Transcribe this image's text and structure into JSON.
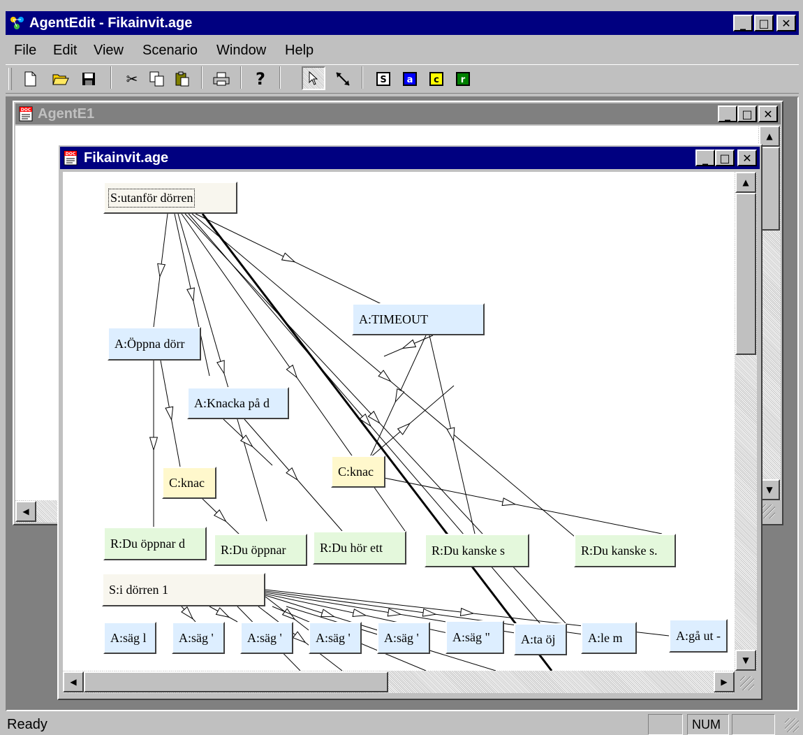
{
  "app": {
    "title": "AgentEdit - Fikainvit.age",
    "caption_buttons": {
      "minimize": "_",
      "maximize": "□",
      "close": "✕"
    }
  },
  "menu": [
    "File",
    "Edit",
    "View",
    "Scenario",
    "Window",
    "Help"
  ],
  "toolbar": {
    "icons": [
      "new-document-icon",
      "open-folder-icon",
      "save-icon",
      "cut-icon",
      "copy-icon",
      "paste-icon",
      "print-icon",
      "help-icon",
      "pointer-select-icon",
      "connect-arrow-icon",
      "state-node-icon",
      "action-node-icon",
      "condition-node-icon",
      "response-node-icon"
    ],
    "node_letters": {
      "s": "S",
      "a": "a",
      "c": "c",
      "r": "r"
    },
    "node_colors": {
      "s": "#ffffff",
      "a": "#0000ff",
      "c": "#ffff00",
      "r": "#008000"
    }
  },
  "outer_window": {
    "title": "AgentE1"
  },
  "inner_window": {
    "title": "Fikainvit.age"
  },
  "nodes": [
    {
      "key": "n0",
      "kind": "state",
      "label": "S:utanför dörren",
      "selected": true
    },
    {
      "key": "n1",
      "kind": "action",
      "label": "A:TIMEOUT"
    },
    {
      "key": "n2",
      "kind": "action",
      "label": "A:Öppna dörr"
    },
    {
      "key": "n3",
      "kind": "action",
      "label": "A:Knacka på d"
    },
    {
      "key": "n4",
      "kind": "condition",
      "label": "C:knac"
    },
    {
      "key": "n5",
      "kind": "condition",
      "label": "C:knac"
    },
    {
      "key": "n6",
      "kind": "response",
      "label": "R:Du öppnar d"
    },
    {
      "key": "n7",
      "kind": "response",
      "label": "R:Du öppnar"
    },
    {
      "key": "n8",
      "kind": "response",
      "label": "R:Du hör ett"
    },
    {
      "key": "n9",
      "kind": "response",
      "label": "R:Du kanske s"
    },
    {
      "key": "n10",
      "kind": "response",
      "label": "R:Du kanske s."
    },
    {
      "key": "n11",
      "kind": "state",
      "label": "S:i dörren 1"
    },
    {
      "key": "n12",
      "kind": "action",
      "label": "A:säg l"
    },
    {
      "key": "n13",
      "kind": "action",
      "label": "A:säg '"
    },
    {
      "key": "n14",
      "kind": "action",
      "label": "A:säg '"
    },
    {
      "key": "n15",
      "kind": "action",
      "label": "A:säg '"
    },
    {
      "key": "n16",
      "kind": "action",
      "label": "A:säg '"
    },
    {
      "key": "n17",
      "kind": "action",
      "label": "A:säg \""
    },
    {
      "key": "n18",
      "kind": "action",
      "label": "A:ta öj"
    },
    {
      "key": "n19",
      "kind": "action",
      "label": "A:le m"
    },
    {
      "key": "n20",
      "kind": "action",
      "label": "A:gå ut -"
    }
  ],
  "colors": {
    "titlebar_active": "#000080",
    "titlebar_inactive": "#808080",
    "chrome": "#c0c0c0",
    "mdi_background": "#808080",
    "state_node": "#f8f6ee",
    "action_node": "#ddeeff",
    "condition_node": "#fff8cc",
    "response_node": "#e4f8dc"
  },
  "status": {
    "text": "Ready",
    "num_indicator": "NUM"
  }
}
